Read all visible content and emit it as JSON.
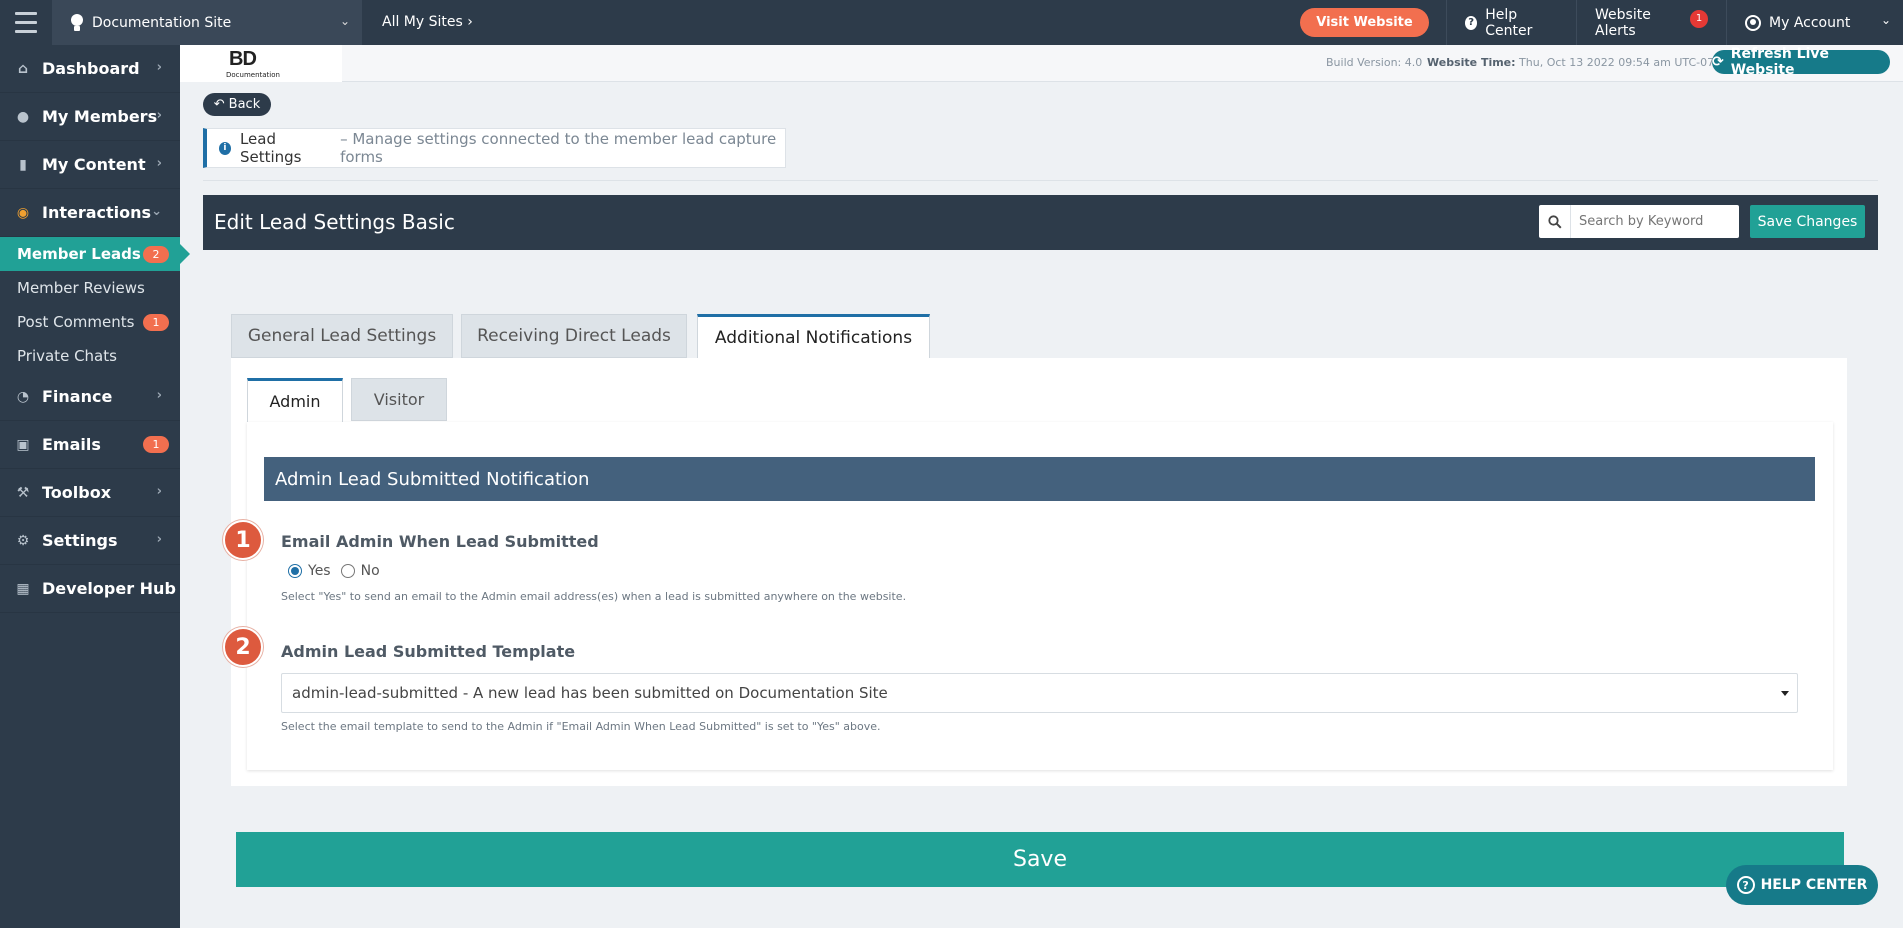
{
  "topbar": {
    "site_name": "Documentation Site",
    "all_sites": "All My Sites",
    "visit_website": "Visit Website",
    "help_center": "Help Center",
    "website_alerts": "Website Alerts",
    "alerts_count": "1",
    "my_account": "My Account"
  },
  "sidebar": {
    "items": [
      {
        "label": "Dashboard",
        "icon": "home-icon"
      },
      {
        "label": "My Members",
        "icon": "users-icon"
      },
      {
        "label": "My Content",
        "icon": "folder-icon"
      },
      {
        "label": "Interactions",
        "icon": "chat-icon"
      },
      {
        "label": "Finance",
        "icon": "pie-chart-icon"
      },
      {
        "label": "Emails",
        "icon": "inbox-icon",
        "badge": "1"
      },
      {
        "label": "Toolbox",
        "icon": "wrench-icon"
      },
      {
        "label": "Settings",
        "icon": "gear-icon"
      },
      {
        "label": "Developer Hub",
        "icon": "grid-icon"
      }
    ],
    "sub_items": [
      {
        "label": "Member Leads",
        "badge": "2"
      },
      {
        "label": "Member Reviews"
      },
      {
        "label": "Post Comments",
        "badge": "1"
      },
      {
        "label": "Private Chats"
      }
    ]
  },
  "header": {
    "logo_text": "BD",
    "logo_sub": "Documentation",
    "build_version": "Build Version: 4.0",
    "website_time_label": "Website Time:",
    "website_time_value": "Thu, Oct 13 2022 09:54 am UTC-07:00",
    "refresh_label": "Refresh Live Website"
  },
  "main": {
    "back_label": "Back",
    "info_title": "Lead Settings",
    "info_desc": "– Manage settings connected to the member lead capture forms",
    "panel_title": "Edit Lead Settings Basic",
    "search_placeholder": "Search by Keyword",
    "save_changes": "Save Changes",
    "tabs": [
      "General Lead Settings",
      "Receiving Direct Leads",
      "Additional Notifications"
    ],
    "subtabs": [
      "Admin",
      "Visitor"
    ],
    "section_title": "Admin Lead Submitted Notification",
    "field1": {
      "number": "1",
      "label": "Email Admin When Lead Submitted",
      "yes": "Yes",
      "no": "No",
      "help": "Select \"Yes\" to send an email to the Admin email address(es) when a lead is submitted anywhere on the website."
    },
    "field2": {
      "number": "2",
      "label": "Admin Lead Submitted Template",
      "value": "admin-lead-submitted - A new lead has been submitted on Documentation Site",
      "help": "Select the email template to send to the Admin if \"Email Admin When Lead Submitted\" is set to \"Yes\" above."
    },
    "save_label": "Save",
    "help_center_float": "HELP CENTER"
  },
  "colors": {
    "dark": "#2d3b4a",
    "teal": "#21a196",
    "orange": "#f26f4f",
    "blue": "#1f6fa6",
    "section": "#44617d"
  }
}
